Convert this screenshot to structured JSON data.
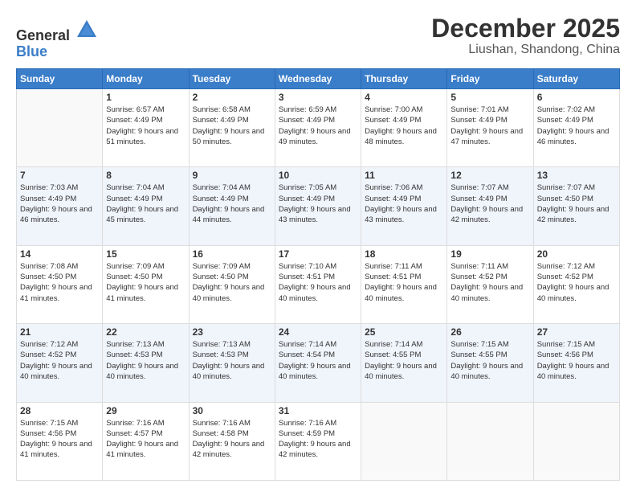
{
  "header": {
    "logo_general": "General",
    "logo_blue": "Blue",
    "month": "December 2025",
    "location": "Liushan, Shandong, China"
  },
  "weekdays": [
    "Sunday",
    "Monday",
    "Tuesday",
    "Wednesday",
    "Thursday",
    "Friday",
    "Saturday"
  ],
  "weeks": [
    [
      {
        "day": "",
        "empty": true
      },
      {
        "day": "1",
        "sunrise": "Sunrise: 6:57 AM",
        "sunset": "Sunset: 4:49 PM",
        "daylight": "Daylight: 9 hours and 51 minutes."
      },
      {
        "day": "2",
        "sunrise": "Sunrise: 6:58 AM",
        "sunset": "Sunset: 4:49 PM",
        "daylight": "Daylight: 9 hours and 50 minutes."
      },
      {
        "day": "3",
        "sunrise": "Sunrise: 6:59 AM",
        "sunset": "Sunset: 4:49 PM",
        "daylight": "Daylight: 9 hours and 49 minutes."
      },
      {
        "day": "4",
        "sunrise": "Sunrise: 7:00 AM",
        "sunset": "Sunset: 4:49 PM",
        "daylight": "Daylight: 9 hours and 48 minutes."
      },
      {
        "day": "5",
        "sunrise": "Sunrise: 7:01 AM",
        "sunset": "Sunset: 4:49 PM",
        "daylight": "Daylight: 9 hours and 47 minutes."
      },
      {
        "day": "6",
        "sunrise": "Sunrise: 7:02 AM",
        "sunset": "Sunset: 4:49 PM",
        "daylight": "Daylight: 9 hours and 46 minutes."
      }
    ],
    [
      {
        "day": "7",
        "sunrise": "Sunrise: 7:03 AM",
        "sunset": "Sunset: 4:49 PM",
        "daylight": "Daylight: 9 hours and 46 minutes."
      },
      {
        "day": "8",
        "sunrise": "Sunrise: 7:04 AM",
        "sunset": "Sunset: 4:49 PM",
        "daylight": "Daylight: 9 hours and 45 minutes."
      },
      {
        "day": "9",
        "sunrise": "Sunrise: 7:04 AM",
        "sunset": "Sunset: 4:49 PM",
        "daylight": "Daylight: 9 hours and 44 minutes."
      },
      {
        "day": "10",
        "sunrise": "Sunrise: 7:05 AM",
        "sunset": "Sunset: 4:49 PM",
        "daylight": "Daylight: 9 hours and 43 minutes."
      },
      {
        "day": "11",
        "sunrise": "Sunrise: 7:06 AM",
        "sunset": "Sunset: 4:49 PM",
        "daylight": "Daylight: 9 hours and 43 minutes."
      },
      {
        "day": "12",
        "sunrise": "Sunrise: 7:07 AM",
        "sunset": "Sunset: 4:49 PM",
        "daylight": "Daylight: 9 hours and 42 minutes."
      },
      {
        "day": "13",
        "sunrise": "Sunrise: 7:07 AM",
        "sunset": "Sunset: 4:50 PM",
        "daylight": "Daylight: 9 hours and 42 minutes."
      }
    ],
    [
      {
        "day": "14",
        "sunrise": "Sunrise: 7:08 AM",
        "sunset": "Sunset: 4:50 PM",
        "daylight": "Daylight: 9 hours and 41 minutes."
      },
      {
        "day": "15",
        "sunrise": "Sunrise: 7:09 AM",
        "sunset": "Sunset: 4:50 PM",
        "daylight": "Daylight: 9 hours and 41 minutes."
      },
      {
        "day": "16",
        "sunrise": "Sunrise: 7:09 AM",
        "sunset": "Sunset: 4:50 PM",
        "daylight": "Daylight: 9 hours and 40 minutes."
      },
      {
        "day": "17",
        "sunrise": "Sunrise: 7:10 AM",
        "sunset": "Sunset: 4:51 PM",
        "daylight": "Daylight: 9 hours and 40 minutes."
      },
      {
        "day": "18",
        "sunrise": "Sunrise: 7:11 AM",
        "sunset": "Sunset: 4:51 PM",
        "daylight": "Daylight: 9 hours and 40 minutes."
      },
      {
        "day": "19",
        "sunrise": "Sunrise: 7:11 AM",
        "sunset": "Sunset: 4:52 PM",
        "daylight": "Daylight: 9 hours and 40 minutes."
      },
      {
        "day": "20",
        "sunrise": "Sunrise: 7:12 AM",
        "sunset": "Sunset: 4:52 PM",
        "daylight": "Daylight: 9 hours and 40 minutes."
      }
    ],
    [
      {
        "day": "21",
        "sunrise": "Sunrise: 7:12 AM",
        "sunset": "Sunset: 4:52 PM",
        "daylight": "Daylight: 9 hours and 40 minutes."
      },
      {
        "day": "22",
        "sunrise": "Sunrise: 7:13 AM",
        "sunset": "Sunset: 4:53 PM",
        "daylight": "Daylight: 9 hours and 40 minutes."
      },
      {
        "day": "23",
        "sunrise": "Sunrise: 7:13 AM",
        "sunset": "Sunset: 4:53 PM",
        "daylight": "Daylight: 9 hours and 40 minutes."
      },
      {
        "day": "24",
        "sunrise": "Sunrise: 7:14 AM",
        "sunset": "Sunset: 4:54 PM",
        "daylight": "Daylight: 9 hours and 40 minutes."
      },
      {
        "day": "25",
        "sunrise": "Sunrise: 7:14 AM",
        "sunset": "Sunset: 4:55 PM",
        "daylight": "Daylight: 9 hours and 40 minutes."
      },
      {
        "day": "26",
        "sunrise": "Sunrise: 7:15 AM",
        "sunset": "Sunset: 4:55 PM",
        "daylight": "Daylight: 9 hours and 40 minutes."
      },
      {
        "day": "27",
        "sunrise": "Sunrise: 7:15 AM",
        "sunset": "Sunset: 4:56 PM",
        "daylight": "Daylight: 9 hours and 40 minutes."
      }
    ],
    [
      {
        "day": "28",
        "sunrise": "Sunrise: 7:15 AM",
        "sunset": "Sunset: 4:56 PM",
        "daylight": "Daylight: 9 hours and 41 minutes."
      },
      {
        "day": "29",
        "sunrise": "Sunrise: 7:16 AM",
        "sunset": "Sunset: 4:57 PM",
        "daylight": "Daylight: 9 hours and 41 minutes."
      },
      {
        "day": "30",
        "sunrise": "Sunrise: 7:16 AM",
        "sunset": "Sunset: 4:58 PM",
        "daylight": "Daylight: 9 hours and 42 minutes."
      },
      {
        "day": "31",
        "sunrise": "Sunrise: 7:16 AM",
        "sunset": "Sunset: 4:59 PM",
        "daylight": "Daylight: 9 hours and 42 minutes."
      },
      {
        "day": "",
        "empty": true
      },
      {
        "day": "",
        "empty": true
      },
      {
        "day": "",
        "empty": true
      }
    ]
  ]
}
